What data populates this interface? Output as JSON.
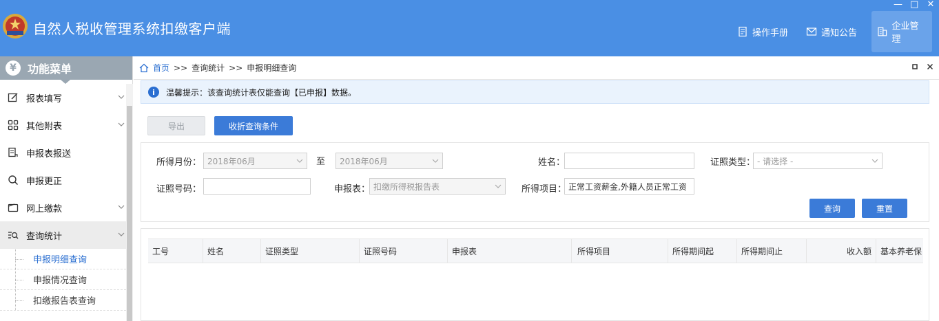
{
  "app": {
    "title": "自然人税收管理系统扣缴客户端",
    "window_controls": [
      "—",
      "□",
      "✕"
    ],
    "header_buttons": [
      {
        "label": "操作手册",
        "icon": "manual-icon"
      },
      {
        "label": "通知公告",
        "icon": "mail-icon"
      },
      {
        "label": "企业管理",
        "icon": "building-icon"
      }
    ]
  },
  "sidebar": {
    "title": "功能菜单",
    "items": [
      {
        "label": "报表填写",
        "icon": "edit-icon",
        "expandable": true
      },
      {
        "label": "其他附表",
        "icon": "grid-icon",
        "expandable": true
      },
      {
        "label": "申报表报送",
        "icon": "report-send-icon",
        "expandable": false
      },
      {
        "label": "申报更正",
        "icon": "search-icon",
        "expandable": false
      },
      {
        "label": "网上缴款",
        "icon": "wallet-icon",
        "expandable": true
      },
      {
        "label": "查询统计",
        "icon": "query-stats-icon",
        "expandable": true
      }
    ],
    "sub_items": [
      {
        "label": "申报明细查询",
        "active": true
      },
      {
        "label": "申报情况查询",
        "active": false
      },
      {
        "label": "扣缴报告表查询",
        "active": false
      }
    ]
  },
  "breadcrumb": {
    "home": "首页",
    "sep": ">>",
    "level1": "查询统计",
    "level2": "申报明细查询"
  },
  "tip": {
    "text": "温馨提示：该查询统计表仅能查询【已申报】数据。"
  },
  "toolbar": {
    "export_label": "导出",
    "collapse_label": "收折查询条件"
  },
  "filters": {
    "month_label": "所得月份：",
    "month_from": "2018年06月",
    "to_label": "至",
    "month_to": "2018年06月",
    "name_label": "姓名：",
    "name_value": "",
    "id_type_label": "证照类型：",
    "id_type_placeholder": "- 请选择 -",
    "id_no_label": "证照号码：",
    "id_no_value": "",
    "report_label": "申报表：",
    "report_value": "扣缴所得税报告表",
    "income_item_label": "所得项目：",
    "income_item_value": "正常工资薪金,外籍人员正常工资",
    "query_label": "查询",
    "reset_label": "重置"
  },
  "table": {
    "columns": [
      "工号",
      "姓名",
      "证照类型",
      "证照号码",
      "申报表",
      "所得项目",
      "所得期间起",
      "所得期间止",
      "收入额",
      "基本养老保"
    ]
  },
  "colors": {
    "header_bg": "#4a8fe4",
    "primary": "#3b7bd8",
    "link": "#2b6fd1",
    "menu_head": "#9aa7b2"
  }
}
